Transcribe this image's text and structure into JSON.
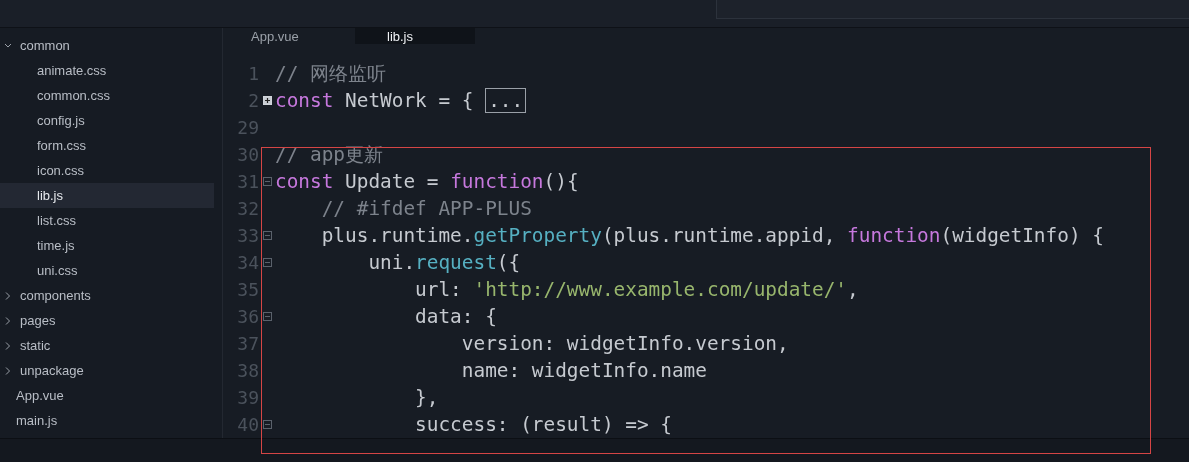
{
  "sidebar": {
    "items": [
      {
        "label": "common",
        "expanded": true,
        "selected": false,
        "children": [
          {
            "label": "animate.css",
            "selected": false
          },
          {
            "label": "common.css",
            "selected": false
          },
          {
            "label": "config.js",
            "selected": false
          },
          {
            "label": "form.css",
            "selected": false
          },
          {
            "label": "icon.css",
            "selected": false
          },
          {
            "label": "lib.js",
            "selected": true
          },
          {
            "label": "list.css",
            "selected": false
          },
          {
            "label": "time.js",
            "selected": false
          },
          {
            "label": "uni.css",
            "selected": false
          }
        ]
      },
      {
        "label": "components",
        "expanded": false,
        "selected": false
      },
      {
        "label": "pages",
        "expanded": false,
        "selected": false
      },
      {
        "label": "static",
        "expanded": false,
        "selected": false
      },
      {
        "label": "unpackage",
        "expanded": false,
        "selected": false
      },
      {
        "label": "App.vue",
        "selected": false
      },
      {
        "label": "main.js",
        "selected": false
      }
    ]
  },
  "tabs": [
    {
      "label": "App.vue",
      "selected": false
    },
    {
      "label": "lib.js",
      "selected": true
    }
  ],
  "editor": {
    "lines": [
      {
        "number": "1",
        "tokens": [
          {
            "kind": "comment",
            "text": "// 网络监听"
          }
        ]
      },
      {
        "number": "2",
        "collapsed": true,
        "tokens": [
          {
            "kind": "keyword",
            "text": "const"
          },
          {
            "kind": "plain",
            "text": " NetWork = { "
          },
          {
            "kind": "folded",
            "text": "..."
          }
        ]
      },
      {
        "number": "29"
      },
      {
        "number": "30",
        "tokens": [
          {
            "kind": "comment",
            "text": "// app更新"
          }
        ]
      },
      {
        "number": "31",
        "collapsed": false,
        "tokens": [
          {
            "kind": "keyword",
            "text": "const"
          },
          {
            "kind": "plain",
            "text": " Update = "
          },
          {
            "kind": "keyword",
            "text": "function"
          },
          {
            "kind": "plain",
            "text": "(){"
          }
        ]
      },
      {
        "number": "32",
        "tokens": [
          {
            "kind": "comment",
            "text": "    // #ifdef APP-PLUS"
          }
        ]
      },
      {
        "number": "33",
        "collapsed": false,
        "tokens": [
          {
            "kind": "plain",
            "text": "    plus.runtime."
          },
          {
            "kind": "method",
            "text": "getProperty"
          },
          {
            "kind": "plain",
            "text": "(plus.runtime.appid, "
          },
          {
            "kind": "keyword",
            "text": "function"
          },
          {
            "kind": "plain",
            "text": "(widgetInfo) {"
          }
        ]
      },
      {
        "number": "34",
        "collapsed": false,
        "tokens": [
          {
            "kind": "plain",
            "text": "        uni."
          },
          {
            "kind": "method",
            "text": "request"
          },
          {
            "kind": "plain",
            "text": "({"
          }
        ]
      },
      {
        "number": "35",
        "tokens": [
          {
            "kind": "plain",
            "text": "            url: "
          },
          {
            "kind": "string",
            "text": "'http://www.example.com/update/'"
          },
          {
            "kind": "plain",
            "text": ","
          }
        ]
      },
      {
        "number": "36",
        "collapsed": false,
        "tokens": [
          {
            "kind": "plain",
            "text": "            data: {"
          }
        ]
      },
      {
        "number": "37",
        "tokens": [
          {
            "kind": "plain",
            "text": "                version: widgetInfo.version,"
          }
        ]
      },
      {
        "number": "38",
        "tokens": [
          {
            "kind": "plain",
            "text": "                name: widgetInfo.name"
          }
        ]
      },
      {
        "number": "39",
        "tokens": [
          {
            "kind": "plain",
            "text": "            },"
          }
        ]
      },
      {
        "number": "40",
        "collapsed": false,
        "tokens": [
          {
            "kind": "plain",
            "text": "            success: (result) => {"
          }
        ]
      }
    ]
  }
}
